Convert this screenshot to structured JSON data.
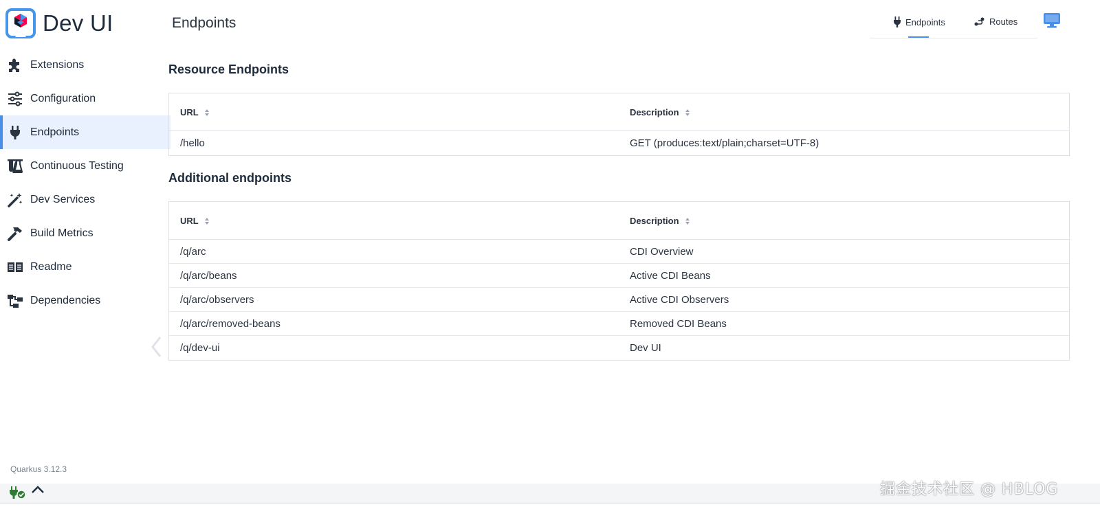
{
  "app": {
    "title": "Dev UI",
    "version": "Quarkus 3.12.3"
  },
  "sidebar": {
    "items": [
      {
        "label": "Extensions",
        "icon": "puzzle-icon"
      },
      {
        "label": "Configuration",
        "icon": "sliders-icon"
      },
      {
        "label": "Endpoints",
        "icon": "plug-icon",
        "active": true
      },
      {
        "label": "Continuous Testing",
        "icon": "flask-icon"
      },
      {
        "label": "Dev Services",
        "icon": "magic-wand-icon"
      },
      {
        "label": "Build Metrics",
        "icon": "hammer-icon"
      },
      {
        "label": "Readme",
        "icon": "book-icon"
      },
      {
        "label": "Dependencies",
        "icon": "diagram-icon"
      }
    ]
  },
  "header": {
    "title": "Endpoints",
    "tabs": [
      {
        "label": "Endpoints",
        "icon": "plug-icon",
        "active": true
      },
      {
        "label": "Routes",
        "icon": "route-icon"
      }
    ]
  },
  "resource_endpoints": {
    "title": "Resource Endpoints",
    "columns": [
      "URL",
      "Description"
    ],
    "rows": [
      {
        "url": "/hello",
        "description": "GET (produces:text/plain;charset=UTF-8)"
      }
    ]
  },
  "additional_endpoints": {
    "title": "Additional endpoints",
    "columns": [
      "URL",
      "Description"
    ],
    "rows": [
      {
        "url": "/q/arc",
        "description": "CDI Overview"
      },
      {
        "url": "/q/arc/beans",
        "description": "Active CDI Beans"
      },
      {
        "url": "/q/arc/observers",
        "description": "Active CDI Observers"
      },
      {
        "url": "/q/arc/removed-beans",
        "description": "Removed CDI Beans"
      },
      {
        "url": "/q/dev-ui",
        "description": "Dev UI"
      }
    ]
  },
  "watermark": "掘金技术社区 @ HBLOG",
  "colors": {
    "accent": "#4a8fe7",
    "active_bg": "#e8f1fd",
    "text": "#1e2b3c",
    "status_green": "#2e7d32"
  }
}
